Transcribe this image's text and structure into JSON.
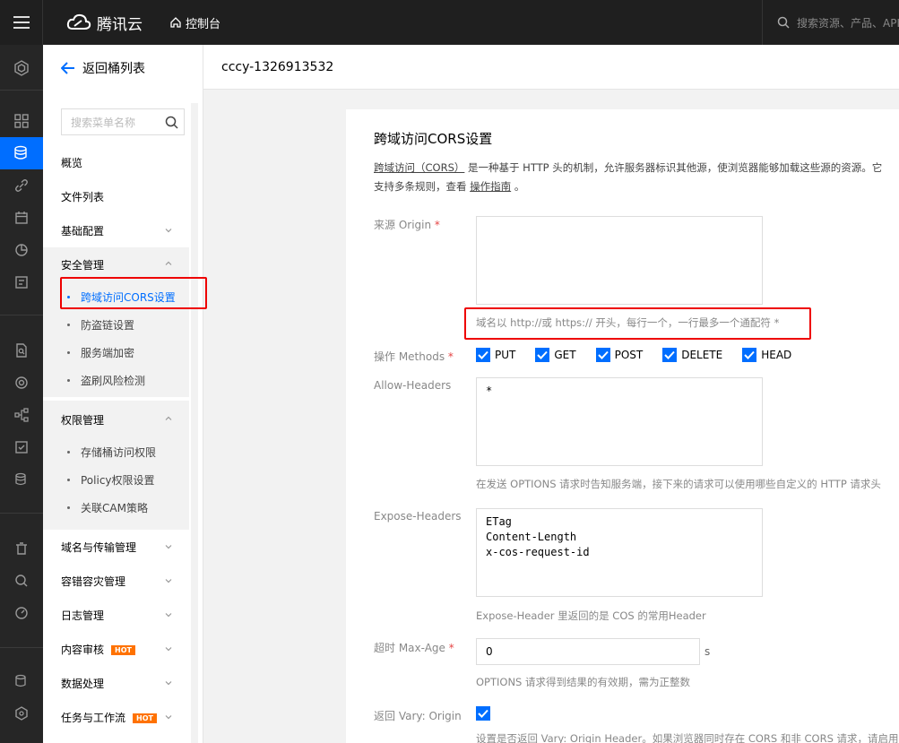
{
  "topbar": {
    "brand": "腾讯云",
    "console": "控制台",
    "search_placeholder": "搜索资源、产品、API"
  },
  "sidebar": {
    "back": "返回桶列表",
    "search_placeholder": "搜索菜单名称",
    "items": {
      "overview": "概览",
      "files": "文件列表",
      "basic": "基础配置",
      "security": "安全管理",
      "permission": "权限管理",
      "domain": "域名与传输管理",
      "disaster": "容错容灾管理",
      "log": "日志管理",
      "content": "内容审核",
      "data": "数据处理",
      "task": "任务与工作流"
    },
    "security_subs": [
      "跨域访问CORS设置",
      "防盗链设置",
      "服务端加密",
      "盗刷风险检测"
    ],
    "permission_subs": [
      "存储桶访问权限",
      "Policy权限设置",
      "关联CAM策略"
    ],
    "hot": "HOT"
  },
  "header": {
    "bucket": "cccy-1326913532"
  },
  "cors": {
    "title": "跨域访问CORS设置",
    "desc_link": "跨域访问（CORS）",
    "desc_line1": "是一种基于 HTTP 头的机制，允许服务器标识其他源，使浏览器能够加载这些源的资源。它",
    "desc_line2a": "支持多条规则，查看",
    "desc_guide": "操作指南",
    "desc_line2b": "。",
    "origin_label": "来源 Origin",
    "origin_value": "",
    "origin_hint": "域名以 http://或 https:// 开头，每行一个，一行最多一个通配符 *",
    "methods_label": "操作 Methods",
    "methods": [
      "PUT",
      "GET",
      "POST",
      "DELETE",
      "HEAD"
    ],
    "allow_label": "Allow-Headers",
    "allow_value": "*",
    "allow_hint": "在发送 OPTIONS 请求时告知服务端，接下来的请求可以使用哪些自定义的 HTTP 请求头",
    "expose_label": "Expose-Headers",
    "expose_value": "ETag\nContent-Length\nx-cos-request-id",
    "expose_hint": "Expose-Header 里返回的是 COS 的常用Header",
    "maxage_label": "超时 Max-Age",
    "maxage_value": "0",
    "maxage_unit": "s",
    "maxage_hint": "OPTIONS 请求得到结果的有效期，需为正整数",
    "vary_label": "返回 Vary: Origin",
    "vary_hint": "设置是否返回 Vary: Origin Header。如果浏览器同时存在 CORS 和非 CORS 请求，请启用该选项"
  },
  "colors": {
    "accent": "#006eff",
    "highlight": "#e00000",
    "hot": "#ff7200"
  }
}
